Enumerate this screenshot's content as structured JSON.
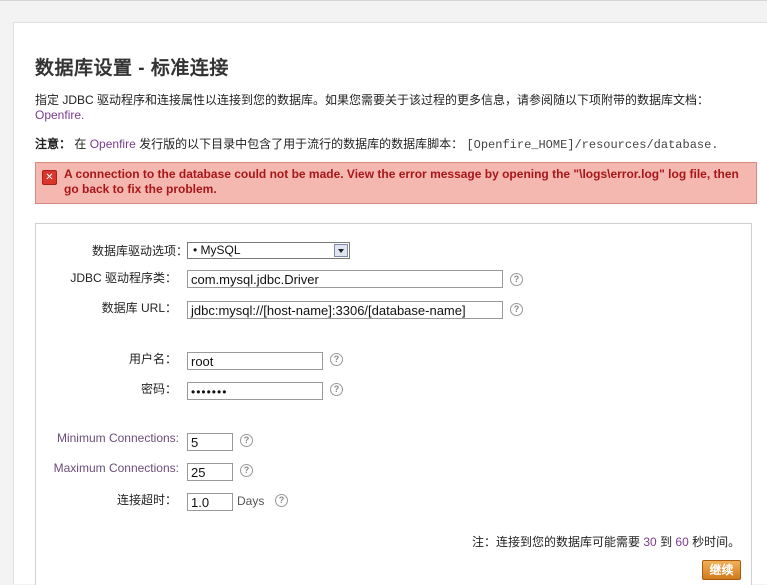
{
  "page": {
    "title": "数据库设置 - 标准连接",
    "intro_text": "指定 JDBC 驱动程序和连接属性以连接到您的数据库。如果您需要关于该过程的更多信息，请参阅随以下项附带的数据库文档：",
    "intro_link": "Openfire.",
    "note_label": "注意：",
    "note_text_1": "在",
    "note_link": "Openfire",
    "note_text_2": "发行版的以下目录中包含了用于流行的数据库的数据库脚本：",
    "note_path": "[Openfire_HOME]/resources/database."
  },
  "error": {
    "icon": "error-x-icon",
    "message": "A connection to the database could not be made. View the error message by opening the \"\\logs\\error.log\" log file, then go back to fix the problem."
  },
  "form": {
    "driver_label": "数据库驱动选项：",
    "driver_selected": "• MySQL",
    "jdbc_label": "JDBC 驱动程序类：",
    "jdbc_value": "com.mysql.jdbc.Driver",
    "url_label": "数据库 URL：",
    "url_value": "jdbc:mysql://[host-name]:3306/[database-name]",
    "username_label": "用户名：",
    "username_value": "root",
    "password_label": "密码：",
    "password_value": "•••••••",
    "min_conn_label": "Minimum Connections:",
    "min_conn_value": "5",
    "max_conn_label": "Maximum Connections:",
    "max_conn_value": "25",
    "timeout_label": "连接超时：",
    "timeout_value": "1.0",
    "timeout_unit": "Days",
    "help_glyph": "?"
  },
  "footer": {
    "note_1": "注：连接到您的数据库可能需要",
    "note_min": "30",
    "note_mid": "到",
    "note_max": "60",
    "note_2": "秒时间。",
    "continue_label": "继续"
  },
  "colors": {
    "error_bg": "#f5b8b0",
    "error_text": "#a8161a",
    "link": "#7b3b8f",
    "button": "#d07a1a"
  }
}
